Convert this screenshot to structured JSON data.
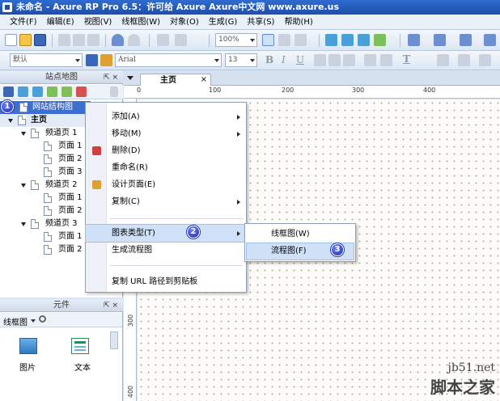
{
  "window": {
    "title": "未命名 - Axure RP Pro 6.5：许可给 Axure Axure中文网 www.axure.us"
  },
  "menubar": {
    "items": [
      "文件(F)",
      "编辑(E)",
      "视图(V)",
      "线框图(W)",
      "对象(O)",
      "生成(G)",
      "共享(S)",
      "帮助(H)"
    ]
  },
  "toolbar1": {
    "zoom_value": "100%"
  },
  "toolbar2": {
    "style_value": "默认",
    "font_value": "Arial",
    "font_size_value": "13",
    "bold": "B",
    "italic": "I",
    "underline": "U",
    "text_color_letter": "T"
  },
  "sitemap_panel": {
    "title": "站点地图",
    "controls": "⇱ ×",
    "tree": [
      {
        "label": "网站结构图",
        "level": 0
      },
      {
        "label": "主页",
        "level": 0
      },
      {
        "label": "频道页 1",
        "level": 1
      },
      {
        "label": "页面 1",
        "level": 2
      },
      {
        "label": "页面 2",
        "level": 2
      },
      {
        "label": "页面 3",
        "level": 2
      },
      {
        "label": "频道页 2",
        "level": 1
      },
      {
        "label": "页面 1",
        "level": 2
      },
      {
        "label": "页面 2",
        "level": 2
      },
      {
        "label": "频道页 3",
        "level": 1
      },
      {
        "label": "页面 1",
        "level": 2
      },
      {
        "label": "页面 2",
        "level": 2
      }
    ]
  },
  "widgets_panel": {
    "title": "元件",
    "controls": "⇱ ×",
    "library_value": "线框图",
    "items": [
      {
        "label": "图片"
      },
      {
        "label": "文本"
      }
    ]
  },
  "canvas": {
    "tab_label": "主页",
    "ruler_top_labels": [
      "0",
      "100",
      "200",
      "300",
      "400"
    ],
    "ruler_left_labels": [
      "300",
      "400"
    ]
  },
  "context_menu": {
    "items": [
      "添加(A)",
      "移动(M)",
      "删除(D)",
      "重命名(R)",
      "设计页面(E)",
      "复制(C)",
      "图表类型(T)",
      "生成流程图",
      "复制 URL 路径到剪贴板"
    ]
  },
  "submenu": {
    "items": [
      "线框图(W)",
      "流程图(F)"
    ]
  },
  "badges": [
    "1",
    "2",
    "3"
  ],
  "watermark": {
    "line1": "jb51.net",
    "line2": "脚本之家"
  },
  "colors": {
    "titlebar": "#1d4fa8",
    "highlight": "#cfe0f7",
    "badge": "#1f2fb8"
  }
}
